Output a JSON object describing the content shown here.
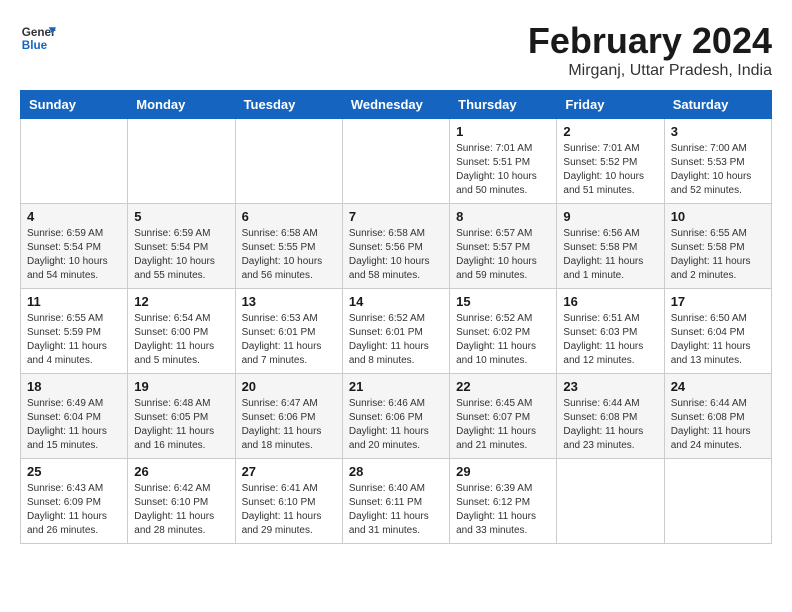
{
  "logo": {
    "general": "General",
    "blue": "Blue"
  },
  "title": "February 2024",
  "location": "Mirganj, Uttar Pradesh, India",
  "days_of_week": [
    "Sunday",
    "Monday",
    "Tuesday",
    "Wednesday",
    "Thursday",
    "Friday",
    "Saturday"
  ],
  "weeks": [
    [
      {
        "day": "",
        "info": ""
      },
      {
        "day": "",
        "info": ""
      },
      {
        "day": "",
        "info": ""
      },
      {
        "day": "",
        "info": ""
      },
      {
        "day": "1",
        "info": "Sunrise: 7:01 AM\nSunset: 5:51 PM\nDaylight: 10 hours\nand 50 minutes."
      },
      {
        "day": "2",
        "info": "Sunrise: 7:01 AM\nSunset: 5:52 PM\nDaylight: 10 hours\nand 51 minutes."
      },
      {
        "day": "3",
        "info": "Sunrise: 7:00 AM\nSunset: 5:53 PM\nDaylight: 10 hours\nand 52 minutes."
      }
    ],
    [
      {
        "day": "4",
        "info": "Sunrise: 6:59 AM\nSunset: 5:54 PM\nDaylight: 10 hours\nand 54 minutes."
      },
      {
        "day": "5",
        "info": "Sunrise: 6:59 AM\nSunset: 5:54 PM\nDaylight: 10 hours\nand 55 minutes."
      },
      {
        "day": "6",
        "info": "Sunrise: 6:58 AM\nSunset: 5:55 PM\nDaylight: 10 hours\nand 56 minutes."
      },
      {
        "day": "7",
        "info": "Sunrise: 6:58 AM\nSunset: 5:56 PM\nDaylight: 10 hours\nand 58 minutes."
      },
      {
        "day": "8",
        "info": "Sunrise: 6:57 AM\nSunset: 5:57 PM\nDaylight: 10 hours\nand 59 minutes."
      },
      {
        "day": "9",
        "info": "Sunrise: 6:56 AM\nSunset: 5:58 PM\nDaylight: 11 hours\nand 1 minute."
      },
      {
        "day": "10",
        "info": "Sunrise: 6:55 AM\nSunset: 5:58 PM\nDaylight: 11 hours\nand 2 minutes."
      }
    ],
    [
      {
        "day": "11",
        "info": "Sunrise: 6:55 AM\nSunset: 5:59 PM\nDaylight: 11 hours\nand 4 minutes."
      },
      {
        "day": "12",
        "info": "Sunrise: 6:54 AM\nSunset: 6:00 PM\nDaylight: 11 hours\nand 5 minutes."
      },
      {
        "day": "13",
        "info": "Sunrise: 6:53 AM\nSunset: 6:01 PM\nDaylight: 11 hours\nand 7 minutes."
      },
      {
        "day": "14",
        "info": "Sunrise: 6:52 AM\nSunset: 6:01 PM\nDaylight: 11 hours\nand 8 minutes."
      },
      {
        "day": "15",
        "info": "Sunrise: 6:52 AM\nSunset: 6:02 PM\nDaylight: 11 hours\nand 10 minutes."
      },
      {
        "day": "16",
        "info": "Sunrise: 6:51 AM\nSunset: 6:03 PM\nDaylight: 11 hours\nand 12 minutes."
      },
      {
        "day": "17",
        "info": "Sunrise: 6:50 AM\nSunset: 6:04 PM\nDaylight: 11 hours\nand 13 minutes."
      }
    ],
    [
      {
        "day": "18",
        "info": "Sunrise: 6:49 AM\nSunset: 6:04 PM\nDaylight: 11 hours\nand 15 minutes."
      },
      {
        "day": "19",
        "info": "Sunrise: 6:48 AM\nSunset: 6:05 PM\nDaylight: 11 hours\nand 16 minutes."
      },
      {
        "day": "20",
        "info": "Sunrise: 6:47 AM\nSunset: 6:06 PM\nDaylight: 11 hours\nand 18 minutes."
      },
      {
        "day": "21",
        "info": "Sunrise: 6:46 AM\nSunset: 6:06 PM\nDaylight: 11 hours\nand 20 minutes."
      },
      {
        "day": "22",
        "info": "Sunrise: 6:45 AM\nSunset: 6:07 PM\nDaylight: 11 hours\nand 21 minutes."
      },
      {
        "day": "23",
        "info": "Sunrise: 6:44 AM\nSunset: 6:08 PM\nDaylight: 11 hours\nand 23 minutes."
      },
      {
        "day": "24",
        "info": "Sunrise: 6:44 AM\nSunset: 6:08 PM\nDaylight: 11 hours\nand 24 minutes."
      }
    ],
    [
      {
        "day": "25",
        "info": "Sunrise: 6:43 AM\nSunset: 6:09 PM\nDaylight: 11 hours\nand 26 minutes."
      },
      {
        "day": "26",
        "info": "Sunrise: 6:42 AM\nSunset: 6:10 PM\nDaylight: 11 hours\nand 28 minutes."
      },
      {
        "day": "27",
        "info": "Sunrise: 6:41 AM\nSunset: 6:10 PM\nDaylight: 11 hours\nand 29 minutes."
      },
      {
        "day": "28",
        "info": "Sunrise: 6:40 AM\nSunset: 6:11 PM\nDaylight: 11 hours\nand 31 minutes."
      },
      {
        "day": "29",
        "info": "Sunrise: 6:39 AM\nSunset: 6:12 PM\nDaylight: 11 hours\nand 33 minutes."
      },
      {
        "day": "",
        "info": ""
      },
      {
        "day": "",
        "info": ""
      }
    ]
  ]
}
